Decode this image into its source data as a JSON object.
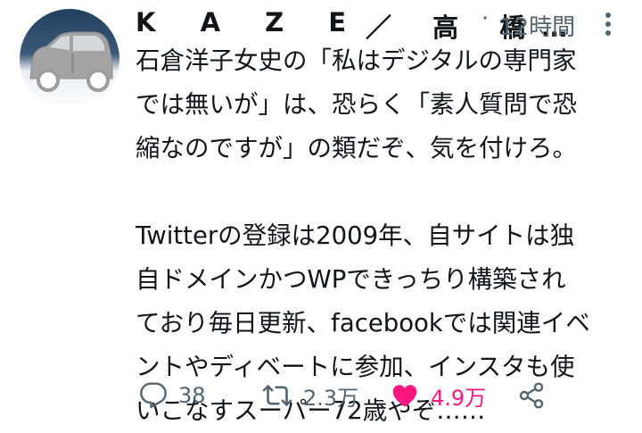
{
  "author": {
    "display_name": "K A Z E",
    "name_suffix": "／ 高 橋…"
  },
  "meta": {
    "separator": "·",
    "timestamp": "12時間"
  },
  "tweet": {
    "lines": [
      "石倉洋子女史の「私はデジタルの専門家",
      "では無いが」は、恐らく「素人質問で恐",
      "縮なのですが」の類だぞ、気を付けろ。",
      "",
      "Twitterの登録は2009年、自サイトは独",
      "自ドメインかつWPできっちり構築され",
      "ており毎日更新、facebookでは関連イベ",
      "ントやディベートに参加、インスタも使",
      "いこなすスーパー72歳やぞ……"
    ]
  },
  "actions": {
    "reply_count": "38",
    "retweet_count": "2.3万",
    "like_count": "4.9万"
  },
  "colors": {
    "text": "#0f1419",
    "secondary": "#536471",
    "like": "#f91880",
    "avatar_bg_top": "#2c4766",
    "avatar_bg_bottom": "#ffffff"
  },
  "icons": {
    "avatar": "car-avatar",
    "more": "more-dots-icon",
    "reply": "reply-icon",
    "retweet": "retweet-icon",
    "like": "heart-icon",
    "share": "share-icon"
  }
}
